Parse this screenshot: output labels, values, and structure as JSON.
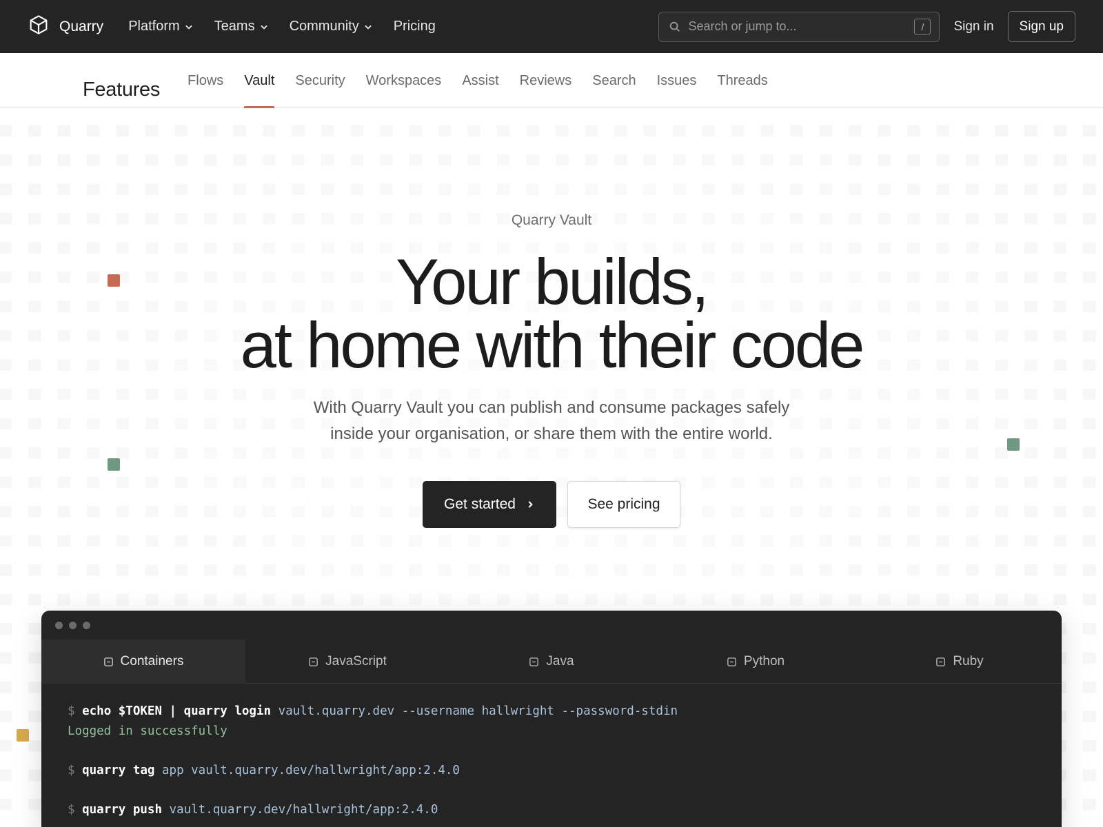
{
  "header": {
    "brand": "Quarry",
    "nav": [
      {
        "label": "Platform",
        "dropdown": true
      },
      {
        "label": "Teams",
        "dropdown": true
      },
      {
        "label": "Community",
        "dropdown": true
      },
      {
        "label": "Pricing",
        "dropdown": false
      }
    ],
    "search_placeholder": "Search or jump to...",
    "search_shortcut": "/",
    "sign_in": "Sign in",
    "sign_up": "Sign up"
  },
  "subnav": {
    "title": "Features",
    "tabs": [
      "Flows",
      "Vault",
      "Security",
      "Workspaces",
      "Assist",
      "Reviews",
      "Search",
      "Issues",
      "Threads"
    ],
    "active_tab": "Vault"
  },
  "hero": {
    "eyebrow": "Quarry Vault",
    "headline_line1": "Your builds,",
    "headline_line2": "at home with their code",
    "lead_line1": "With Quarry Vault you can publish and consume packages safely",
    "lead_line2": "inside your organisation, or share them with the entire world.",
    "primary_cta": "Get started",
    "secondary_cta": "See pricing"
  },
  "terminal": {
    "tabs": [
      "Containers",
      "JavaScript",
      "Java",
      "Python",
      "Ruby"
    ],
    "active_tab": "Containers",
    "lines": {
      "l1_prompt": "$",
      "l1_cmd": "echo $TOKEN | quarry login",
      "l1_args": "vault.quarry.dev --username hallwright --password-stdin",
      "l2_output": "Logged in successfully",
      "l3_prompt": "$",
      "l3_cmd": "quarry tag",
      "l3_args": "app vault.quarry.dev/hallwright/app:2.4.0",
      "l4_prompt": "$",
      "l4_cmd": "quarry push",
      "l4_args": "vault.quarry.dev/hallwright/app:2.4.0"
    }
  },
  "colors": {
    "topbar_bg": "#242424",
    "accent_underline": "#c76a53",
    "square_red": "#c76a53",
    "square_green": "#6f9882",
    "square_yellow": "#d6a94e"
  },
  "icons": [
    "cube-logo-icon",
    "chevron-down-icon",
    "search-icon",
    "chevron-right-icon",
    "package-icon"
  ]
}
